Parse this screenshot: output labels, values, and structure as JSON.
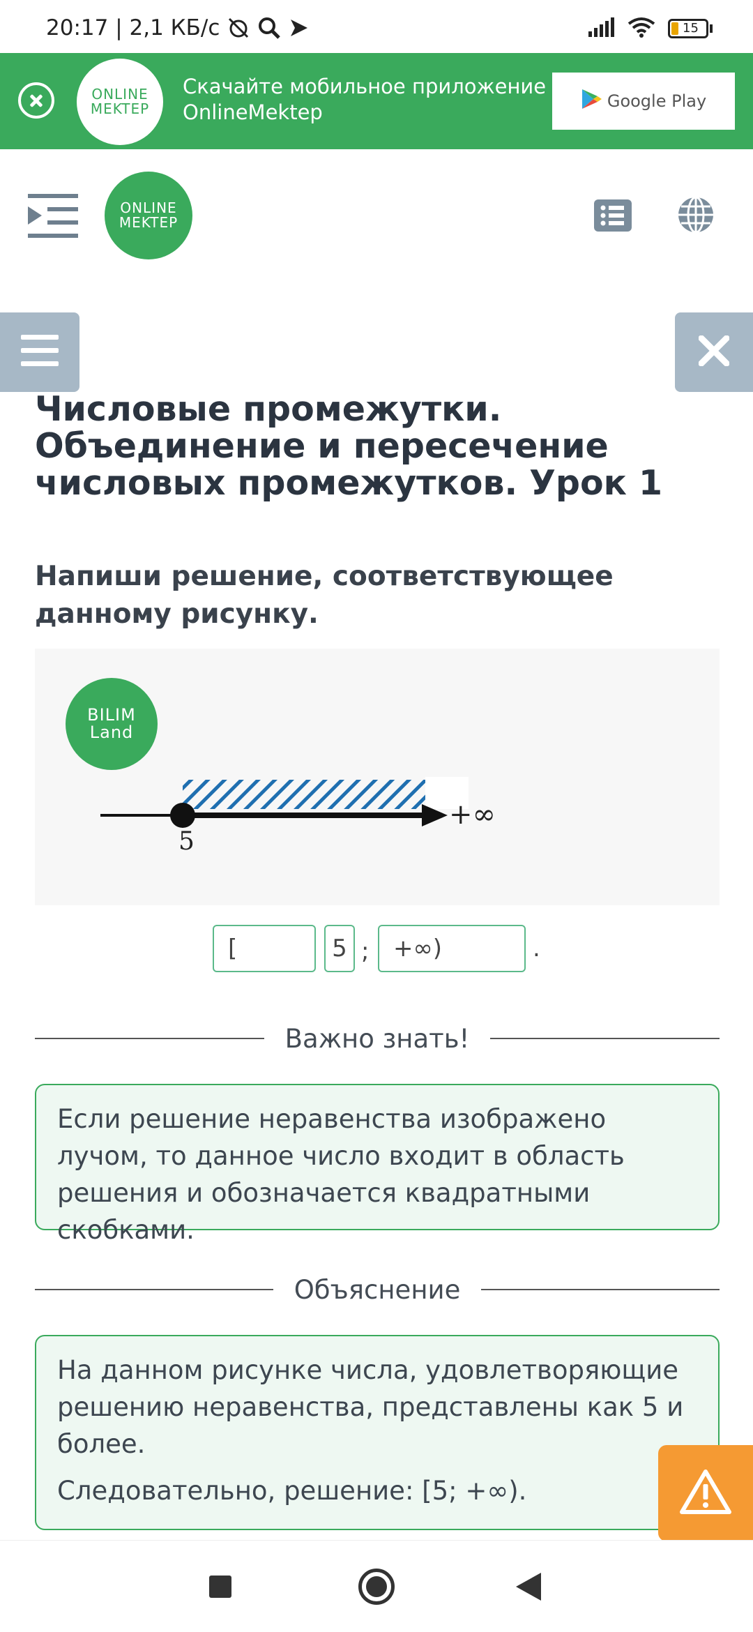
{
  "status_bar": {
    "time_speed": "20:17 | 2,1 КБ/с",
    "battery": "15",
    "icons": [
      "mute-alarm-icon",
      "search-icon",
      "play-icon",
      "signal-icon",
      "wifi-icon",
      "battery-icon"
    ]
  },
  "promo_banner": {
    "logo_line1": "ONLINE",
    "logo_line2": "MEKTEP",
    "line1": "Скачайте мобильное приложение",
    "line2": "OnlineMektep",
    "store_label": "Google Play",
    "bg_color": "#3aaa5c"
  },
  "header": {
    "logo_line1": "ONLINE",
    "logo_line2": "MEKTEP"
  },
  "lesson": {
    "title": "Числовые промежутки. Объединение и пересечение числовых промежутков. Урок 1",
    "task": "Напиши решение, соответствующее данному рисунку."
  },
  "figure": {
    "logo_line1": "BILIM",
    "logo_line2": "Land",
    "point_label": "5",
    "infinity_label": "+∞"
  },
  "answer": {
    "open_bracket": "[",
    "number": "5",
    "separator": ";",
    "close": "+∞)",
    "period": "."
  },
  "important": {
    "heading": "Важно знать!",
    "text": "Если решение неравенства изображено лучом, то данное число входит в область решения и обозначается квадратными скобками."
  },
  "explanation": {
    "heading": "Объяснение",
    "text1": "На данном рисунке числа, удовлетворяющие решению неравенства, представлены как 5 и более.",
    "text2": "Следовательно, решение: [5; +∞)."
  },
  "colors": {
    "accent": "#3aaa5c",
    "float_button": "#a7b8c6",
    "report": "#f59a33",
    "hatch": "#1f6fb0"
  }
}
